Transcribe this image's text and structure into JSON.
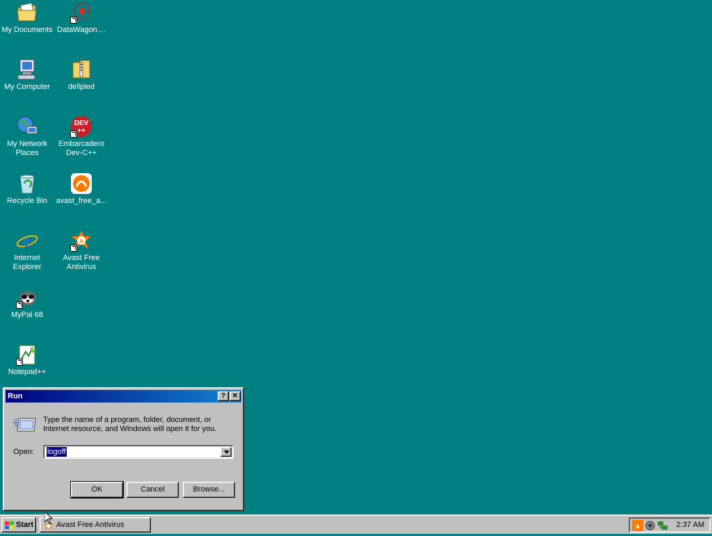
{
  "desktop": {
    "icons": [
      {
        "label": "My Documents",
        "icon": "folder-documents-icon"
      },
      {
        "label": "DataWagon....",
        "icon": "datawagon-icon"
      },
      {
        "label": "My Computer",
        "icon": "computer-icon"
      },
      {
        "label": "dellpled",
        "icon": "zip-folder-icon"
      },
      {
        "label": "My Network Places",
        "icon": "network-places-icon"
      },
      {
        "label": "Embarcadero Dev-C++",
        "icon": "devcpp-icon"
      },
      {
        "label": "Recycle Bin",
        "icon": "recycle-bin-icon"
      },
      {
        "label": "avast_free_a...",
        "icon": "avast-installer-icon"
      },
      {
        "label": "Internet Explorer",
        "icon": "internet-explorer-icon"
      },
      {
        "label": "Avast Free Antivirus",
        "icon": "avast-icon"
      },
      {
        "label": "MyPal 68",
        "icon": "mypal-icon"
      },
      {
        "label": "Notepad++",
        "icon": "notepadpp-icon"
      }
    ]
  },
  "run_dialog": {
    "title": "Run",
    "help_glyph": "?",
    "close_glyph": "✕",
    "description": "Type the name of a program, folder, document, or Internet resource, and Windows will open it for you.",
    "open_label": "Open:",
    "open_value": "logoff",
    "ok_label": "OK",
    "cancel_label": "Cancel",
    "browse_label": "Browse..."
  },
  "taskbar": {
    "start_label": "Start",
    "tasks": [
      {
        "label": "Avast Free Antivirus"
      }
    ],
    "tray_icons": [
      "avast-tray-icon",
      "speaker-tray-icon",
      "network-tray-icon"
    ],
    "clock": "2:37 AM"
  },
  "colors": {
    "desktop": "#008080",
    "titlebar_start": "#000080",
    "titlebar_end": "#1084d0",
    "face": "#c0c0c0",
    "avast_orange": "#ff7800"
  }
}
